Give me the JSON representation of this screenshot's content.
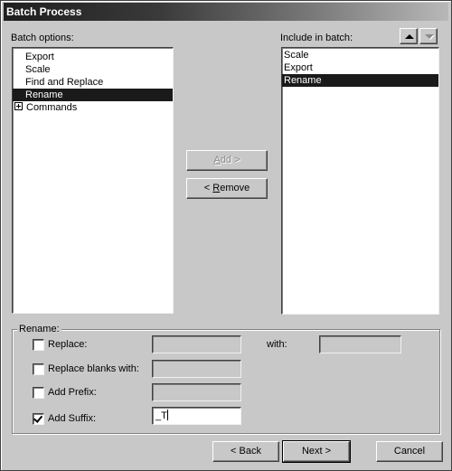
{
  "window": {
    "title": "Batch Process"
  },
  "batch_options": {
    "label": "Batch options:",
    "items": [
      {
        "label": "Export",
        "selected": false,
        "expandable": false
      },
      {
        "label": "Scale",
        "selected": false,
        "expandable": false
      },
      {
        "label": "Find and Replace",
        "selected": false,
        "expandable": false
      },
      {
        "label": "Rename",
        "selected": true,
        "expandable": false
      },
      {
        "label": "Commands",
        "selected": false,
        "expandable": true
      }
    ]
  },
  "include": {
    "label": "Include in batch:",
    "move_up_icon": "triangle-up",
    "move_down_icon": "triangle-down",
    "items": [
      {
        "label": "Scale",
        "selected": false
      },
      {
        "label": "Export",
        "selected": false
      },
      {
        "label": "Rename",
        "selected": true
      }
    ]
  },
  "buttons": {
    "add_accel": "A",
    "add_rest": "dd >",
    "remove_prefix": "< ",
    "remove_accel": "R",
    "remove_rest": "emove",
    "back": "< Back",
    "next": "Next >",
    "cancel": "Cancel"
  },
  "rename": {
    "group_label": "Rename:",
    "replace": {
      "label": "Replace:",
      "checked": false,
      "value": ""
    },
    "with": {
      "label": "with:",
      "value": ""
    },
    "replace_blanks": {
      "label": "Replace blanks with:",
      "checked": false,
      "value": ""
    },
    "add_prefix": {
      "label": "Add Prefix:",
      "checked": false,
      "value": ""
    },
    "add_suffix": {
      "label": "Add Suffix:",
      "checked": true,
      "value": "_T"
    }
  }
}
